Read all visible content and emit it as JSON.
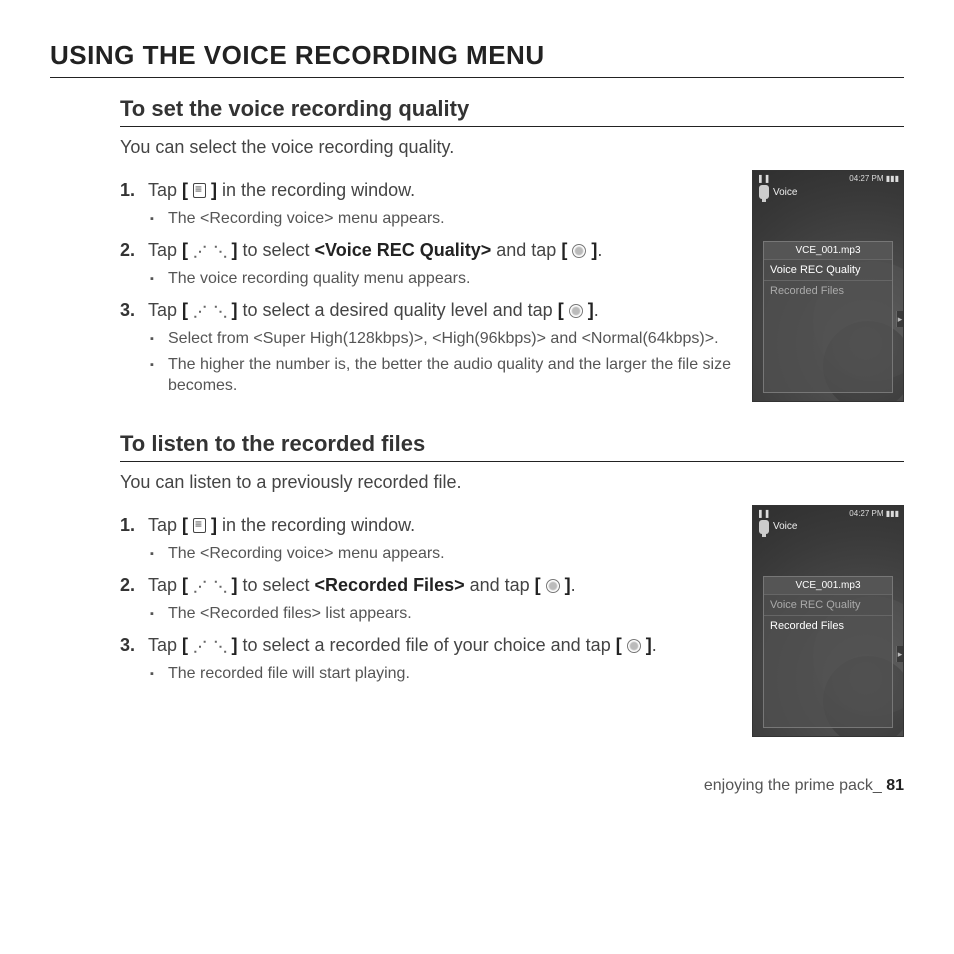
{
  "title": "USING THE VOICE RECORDING MENU",
  "section1": {
    "heading": "To set the voice recording quality",
    "intro": "You can select the voice recording quality.",
    "step1": "in the recording window.",
    "step1_sub1": "The <Recording voice> menu appears.",
    "step2a": "to select ",
    "step2b": "<Voice REC Quality>",
    "step2c": " and tap ",
    "step2_sub1": "The voice recording quality menu appears.",
    "step3a": "to select a desired quality level and tap ",
    "step3_sub1": "Select from <Super High(128kbps)>, <High(96kbps)> and <Normal(64kbps)>.",
    "step3_sub2": "The higher the number is, the better the audio quality and the larger the file size becomes."
  },
  "section2": {
    "heading": "To listen to the recorded files",
    "intro": "You can listen to a previously recorded file.",
    "step1": "in the recording window.",
    "step1_sub1": "The <Recording voice> menu appears.",
    "step2a": "to select ",
    "step2b": "<Recorded Files>",
    "step2c": " and tap ",
    "step2_sub1": "The <Recorded files> list appears.",
    "step3a": "to select a recorded file of your choice and tap ",
    "step3_sub1": "The recorded file will start playing."
  },
  "tap_label": "Tap ",
  "period": ".",
  "device": {
    "time": "04:27 PM",
    "head": "Voice",
    "file": "VCE_001.mp3",
    "item1": "Voice REC Quality",
    "item2": "Recorded Files"
  },
  "footer": {
    "text": "enjoying the prime pack_ ",
    "page": "81"
  }
}
